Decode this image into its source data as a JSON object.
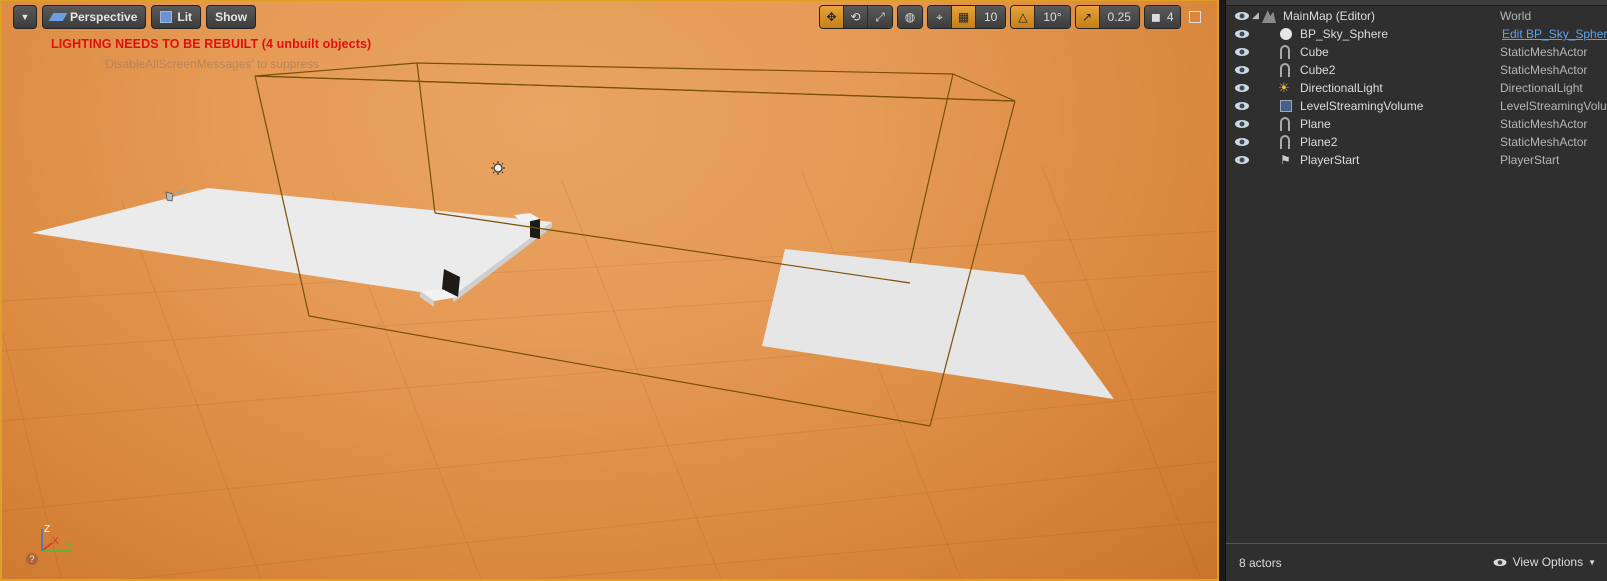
{
  "viewport": {
    "menu_icon": "chevron-down-icon",
    "perspective_label": "Perspective",
    "lit_label": "Lit",
    "show_label": "Show",
    "grid_snap_value": "10",
    "rotation_snap_value": "10°",
    "scale_snap_value": "0.25",
    "camera_speed_value": "4",
    "warning_text": "LIGHTING NEEDS TO BE REBUILT (4 unbuilt objects)",
    "suppress_text": "'DisableAllScreenMessages' to suppress",
    "axis_labels": {
      "z": "Z",
      "x": "X",
      "y": "Y"
    }
  },
  "outliner": {
    "rows": [
      {
        "name": "MainMap (Editor)",
        "type": "World",
        "icon": "world-icon"
      },
      {
        "name": "BP_Sky_Sphere",
        "type": "Edit BP_Sky_Sphere",
        "icon": "sphere-icon"
      },
      {
        "name": "Cube",
        "type": "StaticMeshActor",
        "icon": "static-mesh-icon"
      },
      {
        "name": "Cube2",
        "type": "StaticMeshActor",
        "icon": "static-mesh-icon"
      },
      {
        "name": "DirectionalLight",
        "type": "DirectionalLight",
        "icon": "directional-light-icon"
      },
      {
        "name": "LevelStreamingVolume",
        "type": "LevelStreamingVolume",
        "icon": "volume-icon"
      },
      {
        "name": "Plane",
        "type": "StaticMeshActor",
        "icon": "static-mesh-icon"
      },
      {
        "name": "Plane2",
        "type": "StaticMeshActor",
        "icon": "static-mesh-icon"
      },
      {
        "name": "PlayerStart",
        "type": "PlayerStart",
        "icon": "player-start-icon"
      }
    ],
    "actor_count": "8 actors",
    "view_options_label": "View Options"
  },
  "colors": {
    "accent": "#e0a020",
    "link": "#5ba3f0",
    "warning": "#e01010"
  }
}
